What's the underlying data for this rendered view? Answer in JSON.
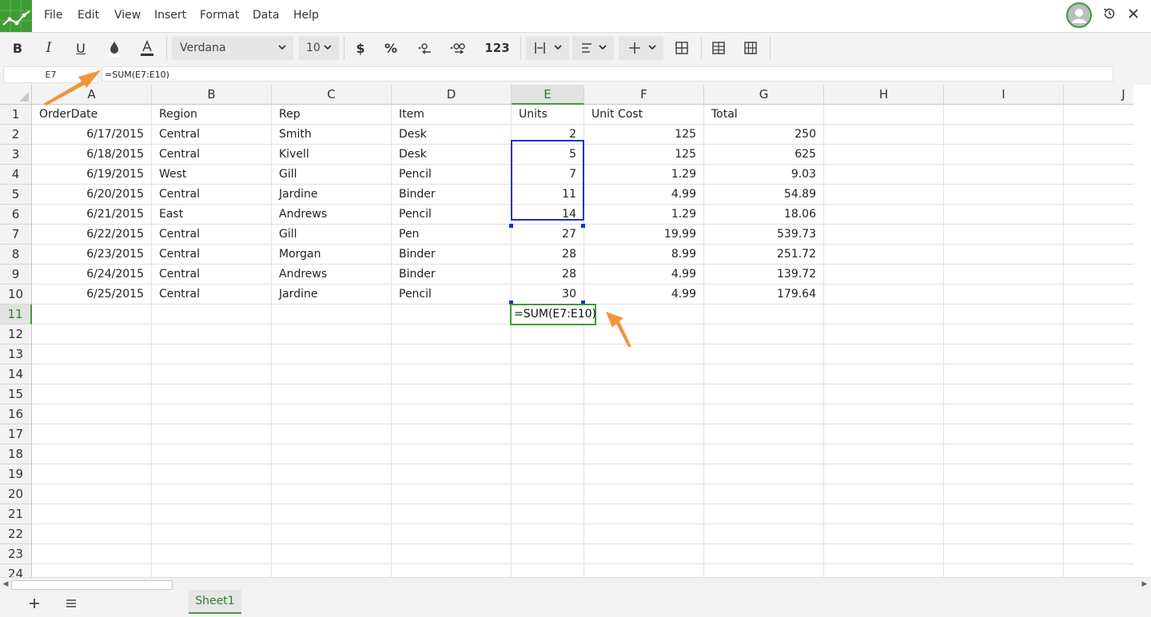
{
  "menu": [
    "File",
    "Edit",
    "View",
    "Insert",
    "Format",
    "Data",
    "Help"
  ],
  "toolbar": {
    "bold": "B",
    "italic": "I",
    "underline": "U",
    "font_name": "Verdana",
    "font_size": "10",
    "currency": "$",
    "percent": "%",
    "number_format": "123"
  },
  "formula_bar": {
    "name_box": "E7",
    "formula": "=SUM(E7:E10)"
  },
  "columns": [
    "A",
    "B",
    "C",
    "D",
    "E",
    "F",
    "G",
    "H",
    "I",
    "J"
  ],
  "row_numbers": [
    "1",
    "2",
    "3",
    "4",
    "5",
    "6",
    "7",
    "8",
    "9",
    "10",
    "11",
    "12",
    "13",
    "14",
    "15",
    "16",
    "17",
    "18",
    "19",
    "20",
    "21",
    "22",
    "23",
    "24"
  ],
  "table": {
    "headers": [
      "OrderDate",
      "Region",
      "Rep",
      "Item",
      "Units",
      "Unit Cost",
      "Total"
    ],
    "rows": [
      [
        "6/17/2015",
        "Central",
        "Smith",
        "Desk",
        "2",
        "125",
        "250"
      ],
      [
        "6/18/2015",
        "Central",
        "Kivell",
        "Desk",
        "5",
        "125",
        "625"
      ],
      [
        "6/19/2015",
        "West",
        "Gill",
        "Pencil",
        "7",
        "1.29",
        "9.03"
      ],
      [
        "6/20/2015",
        "Central",
        "Jardine",
        "Binder",
        "11",
        "4.99",
        "54.89"
      ],
      [
        "6/21/2015",
        "East",
        "Andrews",
        "Pencil",
        "14",
        "1.29",
        "18.06"
      ],
      [
        "6/22/2015",
        "Central",
        "Gill",
        "Pen",
        "27",
        "19.99",
        "539.73"
      ],
      [
        "6/23/2015",
        "Central",
        "Morgan",
        "Binder",
        "28",
        "8.99",
        "251.72"
      ],
      [
        "6/24/2015",
        "Central",
        "Andrews",
        "Binder",
        "28",
        "4.99",
        "139.72"
      ],
      [
        "6/25/2015",
        "Central",
        "Jardine",
        "Pencil",
        "30",
        "4.99",
        "179.64"
      ]
    ]
  },
  "editing_cell": {
    "text": "=SUM(E7:E10)"
  },
  "active_column": "E",
  "active_row": "11",
  "sheet_tab": "Sheet1",
  "colors": {
    "accent": "#3f9c35",
    "selection": "#1d2fd3",
    "annotation": "#f0953a"
  }
}
